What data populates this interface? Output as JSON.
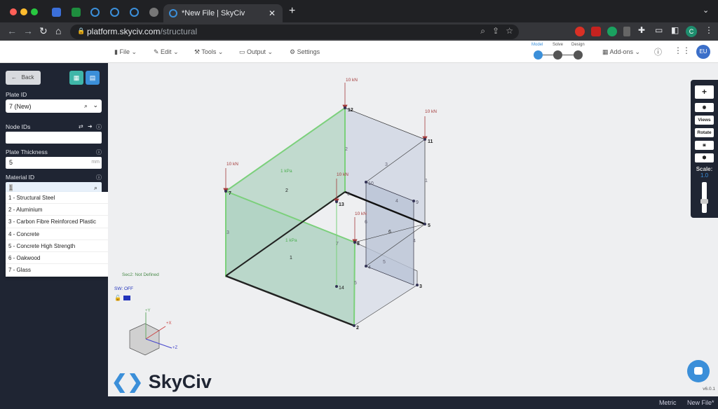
{
  "browser": {
    "tab_title": "*New File | SkyCiv",
    "url_host": "platform.skyciv.com",
    "url_path": "/structural",
    "profile_initial": "C"
  },
  "menu": {
    "file": "File",
    "edit": "Edit",
    "tools": "Tools",
    "output": "Output",
    "settings": "Settings",
    "addons": "Add-ons",
    "user_initials": "EU",
    "steps": [
      {
        "label": "Model",
        "active": true
      },
      {
        "label": "Solve",
        "active": false
      },
      {
        "label": "Design",
        "active": false
      }
    ]
  },
  "sidebar": {
    "back_label": "Back",
    "plate_id_label": "Plate ID",
    "plate_id_value": "7 (New)",
    "node_ids_label": "Node IDs",
    "node_ids_value": "",
    "thickness_label": "Plate Thickness",
    "thickness_value": "5",
    "thickness_unit": "mm",
    "material_label": "Material ID",
    "material_value": "1",
    "materials": [
      "1 - Structural Steel",
      "2 - Aluminium",
      "3 - Carbon Fibre Reinforced Plastic",
      "4 - Concrete",
      "5 - Concrete High Strength",
      "6 - Oakwood",
      "7 - Glass"
    ]
  },
  "viewport": {
    "sec_status": "Sec2: Not Defined",
    "sw_status": "SW: OFF",
    "scale_label": "Scale:",
    "scale_value": "1.0",
    "version": "v6.0.1",
    "brand": "SkyCiv",
    "axes": {
      "y": "+Y",
      "x": "+X",
      "z": "+Z"
    },
    "loads": [
      "10 kN",
      "10 kN",
      "10 kN",
      "10 kN",
      "10 kN"
    ],
    "pressures": [
      "1 kPa",
      "1 kPa"
    ],
    "nodes": [
      "2",
      "3",
      "4",
      "5",
      "6",
      "7",
      "8",
      "9",
      "10",
      "11",
      "12",
      "13",
      "14"
    ],
    "members": [
      "1",
      "2",
      "3",
      "4",
      "5",
      "6",
      "7",
      "3",
      "4",
      "5"
    ],
    "plates": [
      "1",
      "2",
      "4",
      "5",
      "6"
    ]
  },
  "rtools": {
    "add": "+",
    "views": "Views",
    "rotate": "Rotate"
  },
  "status": {
    "units": "Metric",
    "file": "New File*"
  },
  "colors": {
    "accent": "#3b8fd9",
    "green": "#5cb85c",
    "load": "#a33a3a",
    "sidebar": "#1f2533"
  }
}
